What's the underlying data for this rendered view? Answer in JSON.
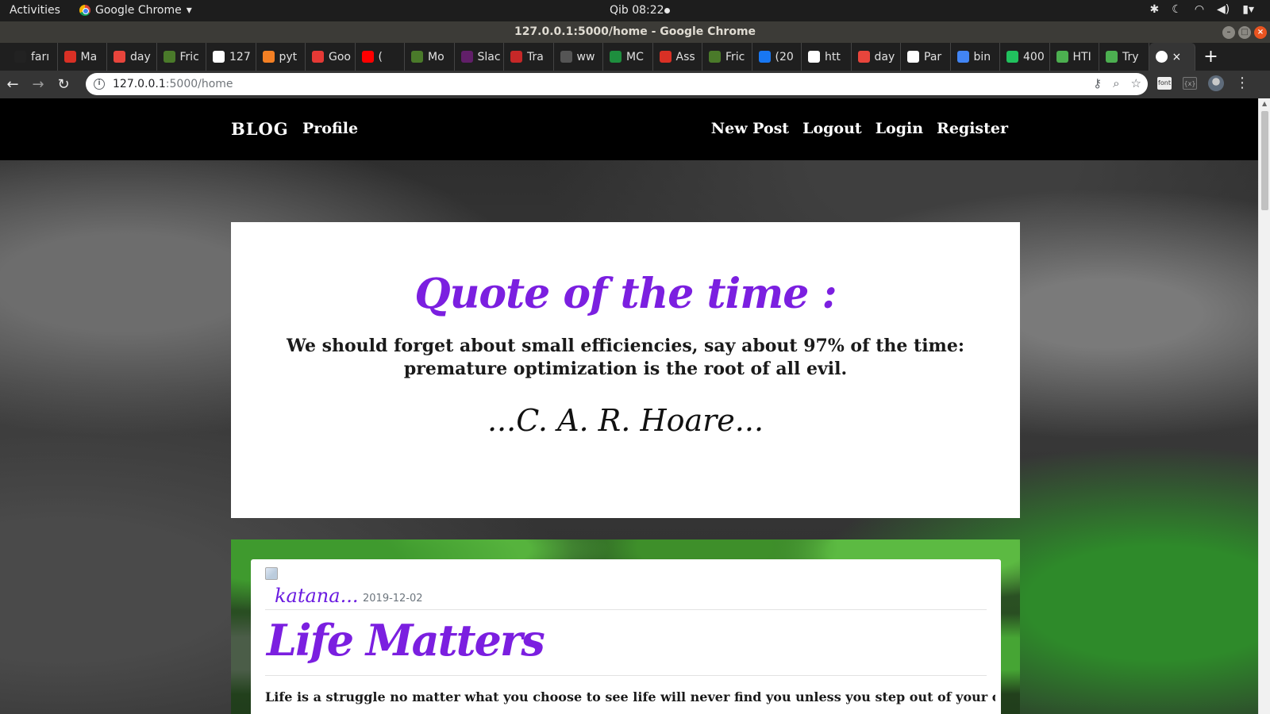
{
  "system_bar": {
    "activities": "Activities",
    "app_name": "Google Chrome",
    "clock": "Qib 08:22"
  },
  "window": {
    "title": "127.0.0.1:5000/home - Google Chrome"
  },
  "tabs": [
    {
      "label": "farı",
      "color": "#222222"
    },
    {
      "label": "Ma",
      "color": "#d93025"
    },
    {
      "label": "day",
      "color": "#e8453c"
    },
    {
      "label": "Fric",
      "color": "#4a7a2a"
    },
    {
      "label": "127",
      "color": "#ffffff"
    },
    {
      "label": "pyt",
      "color": "#f48024"
    },
    {
      "label": "Goo",
      "color": "#e53935"
    },
    {
      "label": "(",
      "color": "#ff0000"
    },
    {
      "label": "Mo",
      "color": "#4a7a2a"
    },
    {
      "label": "Slac",
      "color": "#611f69"
    },
    {
      "label": "Tra",
      "color": "#c62828"
    },
    {
      "label": "ww",
      "color": "#555555"
    },
    {
      "label": "MC",
      "color": "#1e8e3e"
    },
    {
      "label": "Ass",
      "color": "#d93025"
    },
    {
      "label": "Fric",
      "color": "#4a7a2a"
    },
    {
      "label": "(20",
      "color": "#1877f2"
    },
    {
      "label": "htt",
      "color": "#ffffff"
    },
    {
      "label": "day",
      "color": "#e8453c"
    },
    {
      "label": "Par",
      "color": "#ffffff"
    },
    {
      "label": "bin",
      "color": "#4285f4"
    },
    {
      "label": "400",
      "color": "#21c25e"
    },
    {
      "label": "HTI",
      "color": "#4caf50"
    },
    {
      "label": "Try",
      "color": "#4caf50"
    }
  ],
  "active_tab_close": "×",
  "new_tab": "+",
  "address_bar": {
    "host": "127.0.0.1",
    "path": ":5000/home"
  },
  "site": {
    "brand": "BLOG",
    "nav_left": [
      "Profile"
    ],
    "nav_right": [
      "New Post",
      "Logout",
      "Login",
      "Register"
    ]
  },
  "quote": {
    "heading": "Quote of the time :",
    "text": "We should forget about small efficiencies, say about 97% of the time: premature optimization is the root of all evil.",
    "author": "...C. A. R. Hoare..."
  },
  "post": {
    "author": "katana...",
    "date": "2019-12-02",
    "title": "Life Matters",
    "body": "Life is a struggle no matter what you choose to see life will never find you unless you step out of your cages open"
  },
  "colors": {
    "accent_purple": "#7b1fe0",
    "nav_background": "#000000",
    "card_background": "#ffffff"
  }
}
